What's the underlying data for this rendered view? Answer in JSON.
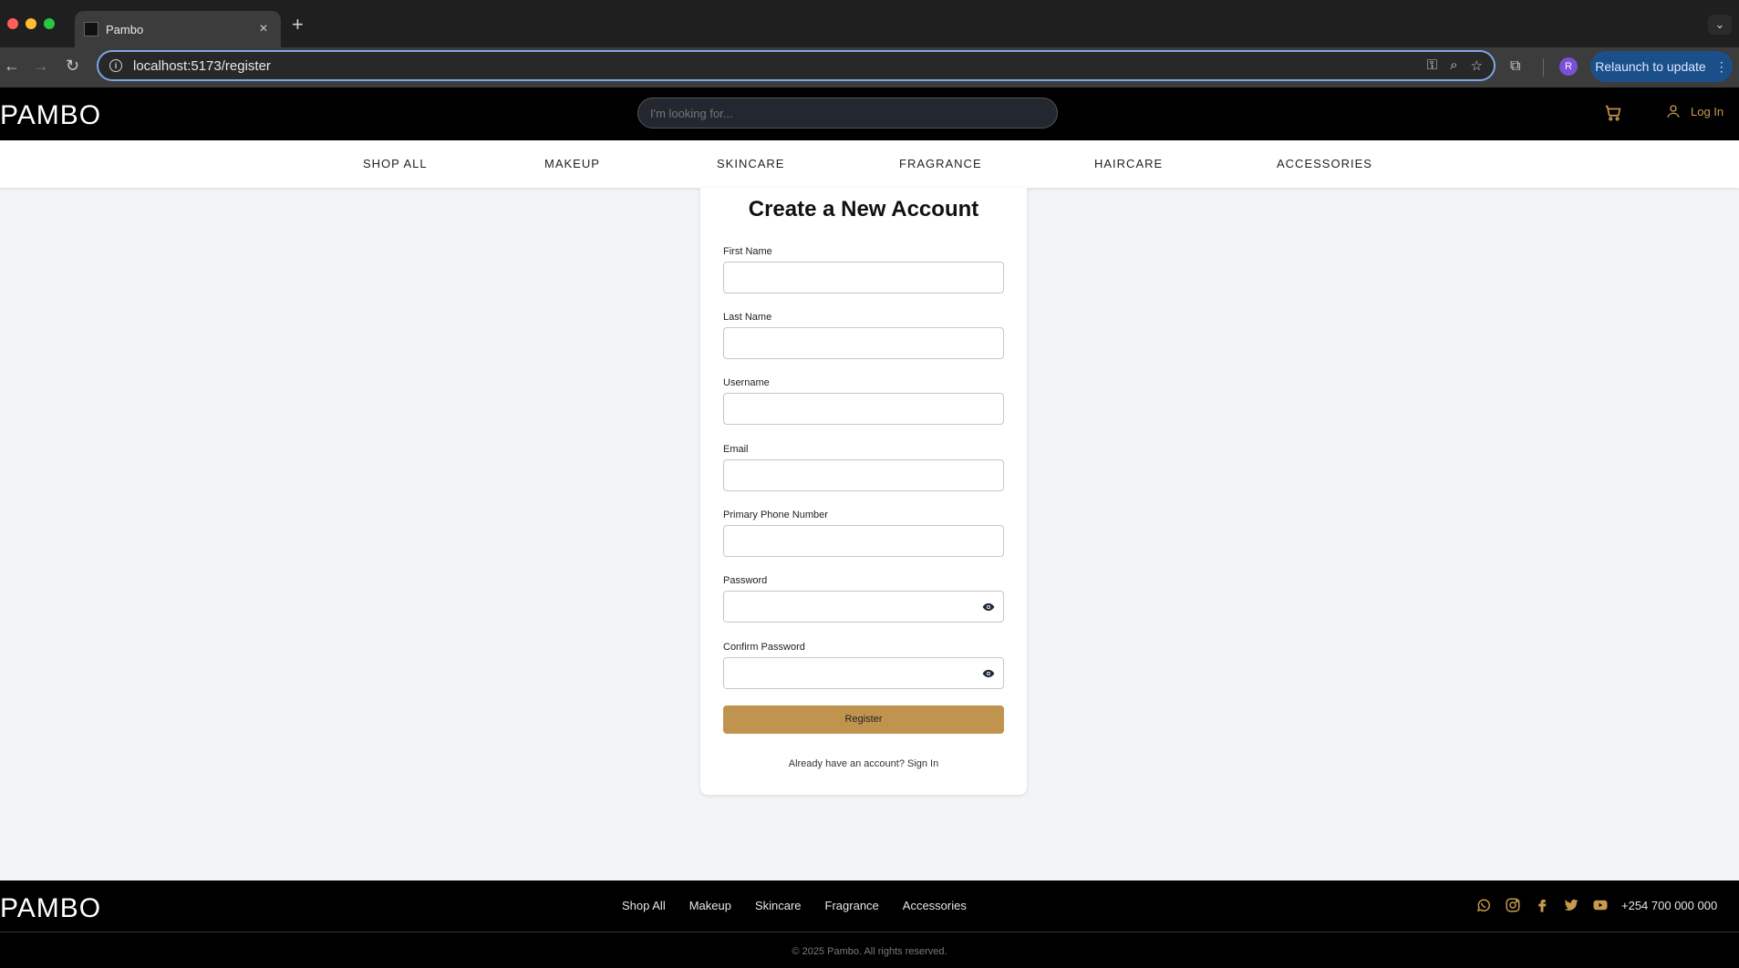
{
  "browser": {
    "tab_title": "Pambo",
    "url": "localhost:5173/register",
    "profile_initial": "R",
    "relaunch_label": "Relaunch to update"
  },
  "header": {
    "logo": "PAMBO",
    "search_placeholder": "I'm looking for...",
    "login_label": "Log In"
  },
  "categories": [
    "SHOP ALL",
    "MAKEUP",
    "SKINCARE",
    "FRAGRANCE",
    "HAIRCARE",
    "ACCESSORIES"
  ],
  "form": {
    "title": "Create a New Account",
    "fields": [
      {
        "label": "First Name",
        "value": ""
      },
      {
        "label": "Last Name",
        "value": ""
      },
      {
        "label": "Username",
        "value": ""
      },
      {
        "label": "Email",
        "value": ""
      },
      {
        "label": "Primary Phone Number",
        "value": ""
      },
      {
        "label": "Password",
        "value": ""
      },
      {
        "label": "Confirm Password",
        "value": ""
      }
    ],
    "register_label": "Register",
    "signin_prompt": "Already have an account? Sign In"
  },
  "footer": {
    "logo": "PAMBO",
    "links": [
      "Shop All",
      "Makeup",
      "Skincare",
      "Fragrance",
      "Accessories"
    ],
    "phone": "+254 700 000 000",
    "copyright": "© 2025 Pambo. All rights reserved.",
    "social_icons": [
      "whatsapp-icon",
      "instagram-icon",
      "facebook-icon",
      "twitter-icon",
      "youtube-icon"
    ]
  },
  "colors": {
    "accent_gold": "#c0944f",
    "header_bg": "#000000",
    "page_bg": "#f3f4f6"
  }
}
